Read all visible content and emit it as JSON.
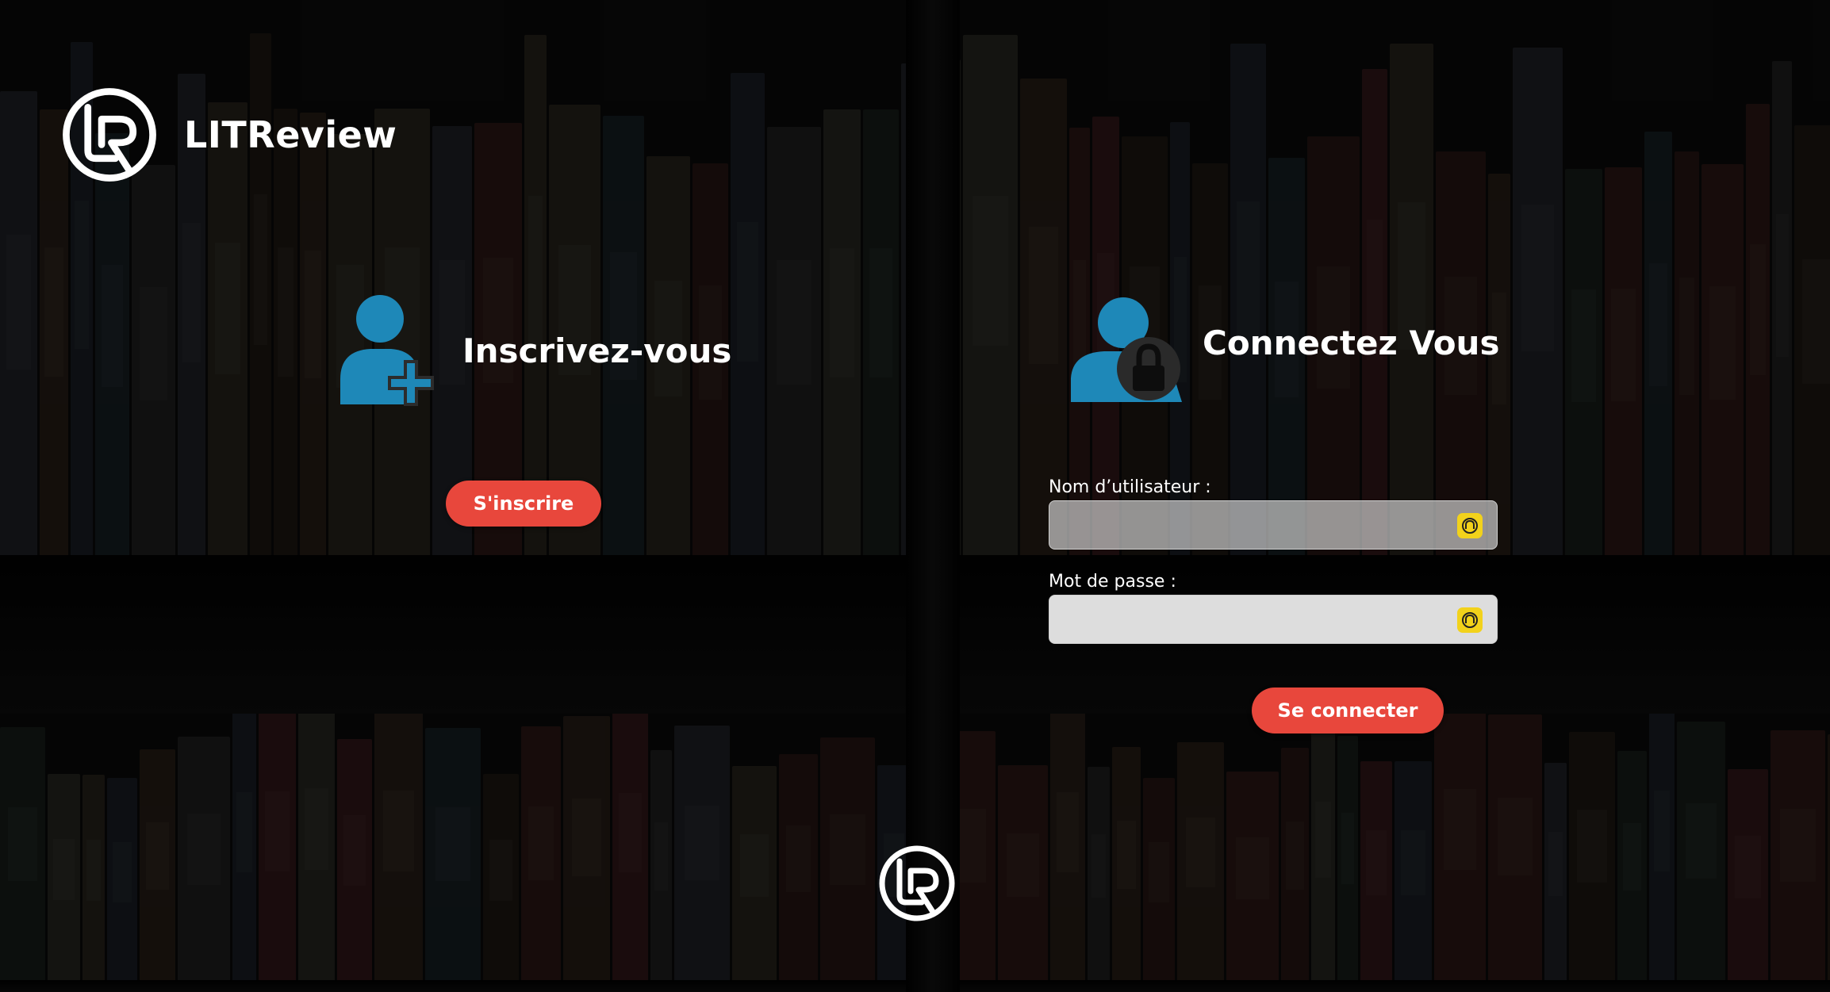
{
  "app": {
    "name": "LITReview"
  },
  "signup": {
    "title": "Inscrivez-vous",
    "button_label": "S'inscrire"
  },
  "login": {
    "title": "Connectez Vous",
    "username_label": "Nom d’utilisateur :",
    "username_value": "",
    "password_label": "Mot de passe :",
    "password_value": "",
    "button_label": "Se connecter"
  },
  "icons": {
    "brand_logo": "litreview-logo-icon",
    "signup": "add-user-icon",
    "login": "user-lock-icon",
    "password_manager": "password-manager-icon",
    "footer_logo": "litreview-logo-icon"
  },
  "colors": {
    "accent": "#e8473c",
    "icon_blue": "#1e88b8",
    "text": "#ffffff",
    "password_manager": "#f2d21b"
  }
}
